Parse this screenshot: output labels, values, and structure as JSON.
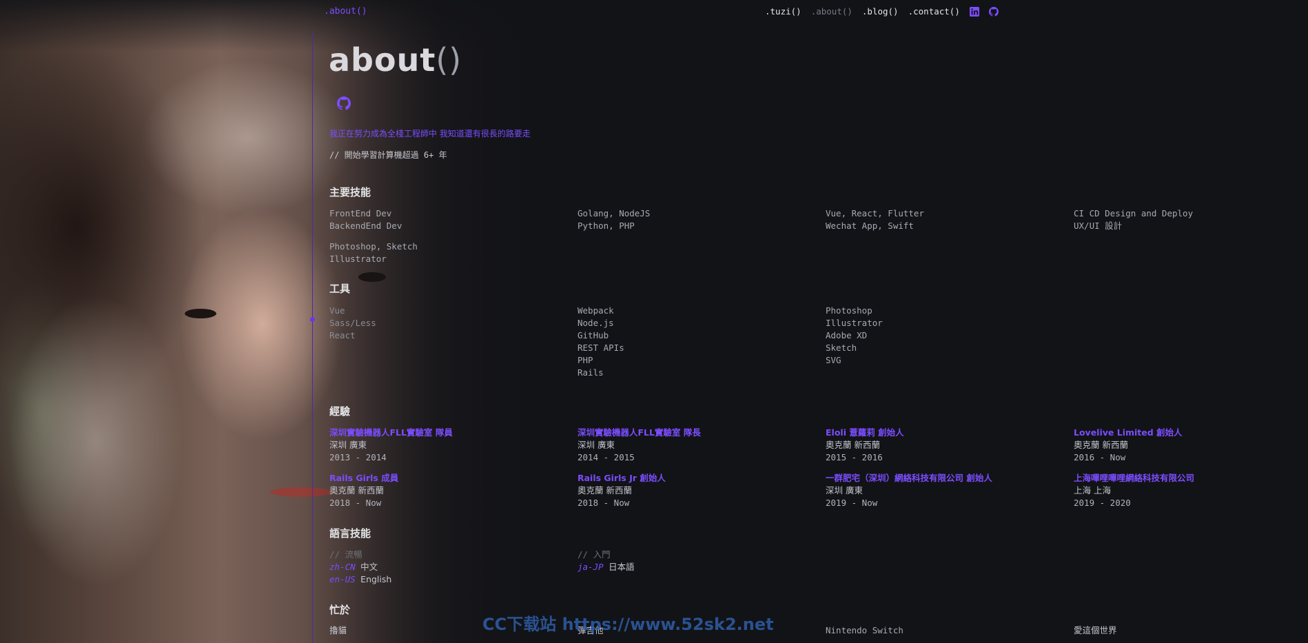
{
  "nav": {
    "brand": ".about()",
    "links": [
      ".tuzi()",
      ".about()",
      ".blog()",
      ".contact()"
    ]
  },
  "header": {
    "title": "about",
    "title_parens": "()",
    "intro": "我正在努力成為全棧工程師中  我知道還有很長的路要走",
    "since": "// 開始學習計算機超過 6+ 年"
  },
  "skills": {
    "title": "主要技能",
    "columns": [
      [
        "FrontEnd Dev",
        "BackendEnd Dev",
        "",
        "Photoshop, Sketch",
        "Illustrator"
      ],
      [
        "Golang, NodeJS",
        "Python, PHP"
      ],
      [
        "Vue, React, Flutter",
        "Wechat App, Swift"
      ],
      [
        "CI CD Design and Deploy",
        "UX/UI 設計"
      ]
    ]
  },
  "tools": {
    "title": "工具",
    "columns": [
      [
        "Vue",
        "Sass/Less",
        "React"
      ],
      [
        "Webpack",
        "Node.js",
        "GitHub",
        "REST APIs",
        "PHP",
        "Rails"
      ],
      [
        "Photoshop",
        "Illustrator",
        "Adobe XD",
        "Sketch",
        "SVG"
      ]
    ]
  },
  "experience": {
    "title": "經驗",
    "items": [
      {
        "role": "深圳實驗機器人FLL實驗室 隊員",
        "loc": "深圳 廣東",
        "years": "2013 - 2014"
      },
      {
        "role": "深圳實驗機器人FLL實驗室 隊長",
        "loc": "深圳 廣東",
        "years": "2014 - 2015"
      },
      {
        "role": "Eloli 薏蘿莉 創始人",
        "loc": "奧克蘭 新西蘭",
        "years": "2015 - 2016"
      },
      {
        "role": "Lovelive Limited 創始人",
        "loc": "奧克蘭 新西蘭",
        "years": "2016 - Now"
      },
      {
        "role": "Rails Girls 成員",
        "loc": "奧克蘭 新西蘭",
        "years": "2018 - Now"
      },
      {
        "role": "Rails Girls Jr 創始人",
        "loc": "奧克蘭 新西蘭",
        "years": "2018 - Now"
      },
      {
        "role": "一群肥宅（深圳）網絡科技有限公司 創始人",
        "loc": "深圳 廣東",
        "years": "2019 - Now"
      },
      {
        "role": "上海嗶哩嗶哩網絡科技有限公司",
        "loc": "上海 上海",
        "years": "2019 - 2020"
      }
    ]
  },
  "languages": {
    "title": "語言技能",
    "groups": [
      {
        "head": "// 流暢",
        "items": [
          {
            "code": "zh-CN",
            "name": "中文"
          },
          {
            "code": "en-US",
            "name": "English"
          }
        ]
      },
      {
        "head": "// 入門",
        "items": [
          {
            "code": "ja-JP",
            "name": "日本語"
          }
        ]
      }
    ]
  },
  "busy": {
    "title": "忙於",
    "items": [
      "擼貓",
      "彈吉他",
      "Nintendo Switch",
      "愛這個世界"
    ]
  },
  "watermark": "CC下载站 https://www.52sk2.net",
  "colors": {
    "accent": "#7c4dff",
    "background": "#121317",
    "text": "#b9bcc4"
  },
  "icons": [
    "linkedin-icon",
    "github-icon"
  ]
}
